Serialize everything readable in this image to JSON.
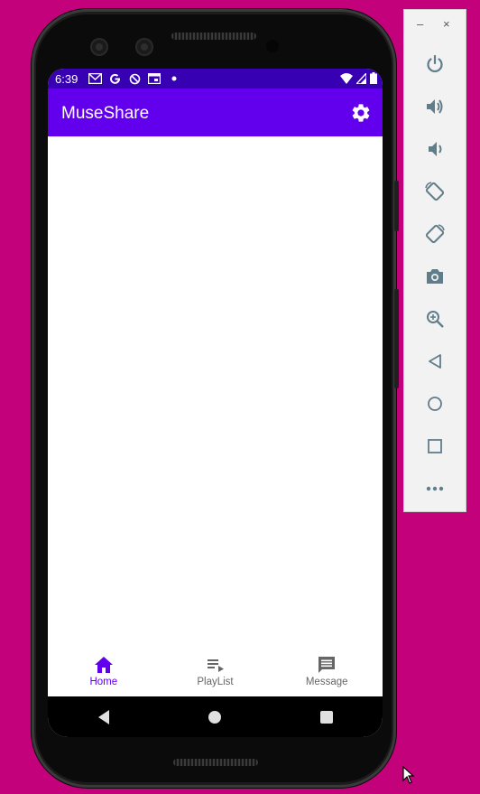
{
  "status_bar": {
    "time": "6:39",
    "notification_icons": [
      "gmail-icon",
      "google-icon",
      "sync-icon",
      "calendar-icon",
      "dot-icon"
    ],
    "right_icons": [
      "wifi-icon",
      "signal-icon",
      "battery-icon"
    ]
  },
  "app_bar": {
    "title": "MuseShare",
    "settings_icon": "gear-icon"
  },
  "bottom_nav": {
    "items": [
      {
        "label": "Home",
        "icon": "home-icon",
        "active": true
      },
      {
        "label": "PlayList",
        "icon": "playlist-icon",
        "active": false
      },
      {
        "label": "Message",
        "icon": "message-icon",
        "active": false
      }
    ]
  },
  "system_nav": [
    "back-icon",
    "home-circle-icon",
    "recents-icon"
  ],
  "emulator_toolbar": {
    "minimize": "–",
    "close": "×",
    "buttons": [
      "power-icon",
      "volume-up-icon",
      "volume-down-icon",
      "rotate-left-icon",
      "rotate-right-icon",
      "camera-icon",
      "zoom-icon",
      "back-icon",
      "home-icon",
      "overview-icon",
      "more-icon"
    ]
  },
  "colors": {
    "background": "#c2017a",
    "status_bar": "#3700b3",
    "app_bar": "#6200ee",
    "active_nav": "#6200ee",
    "inactive_nav": "#666666"
  }
}
